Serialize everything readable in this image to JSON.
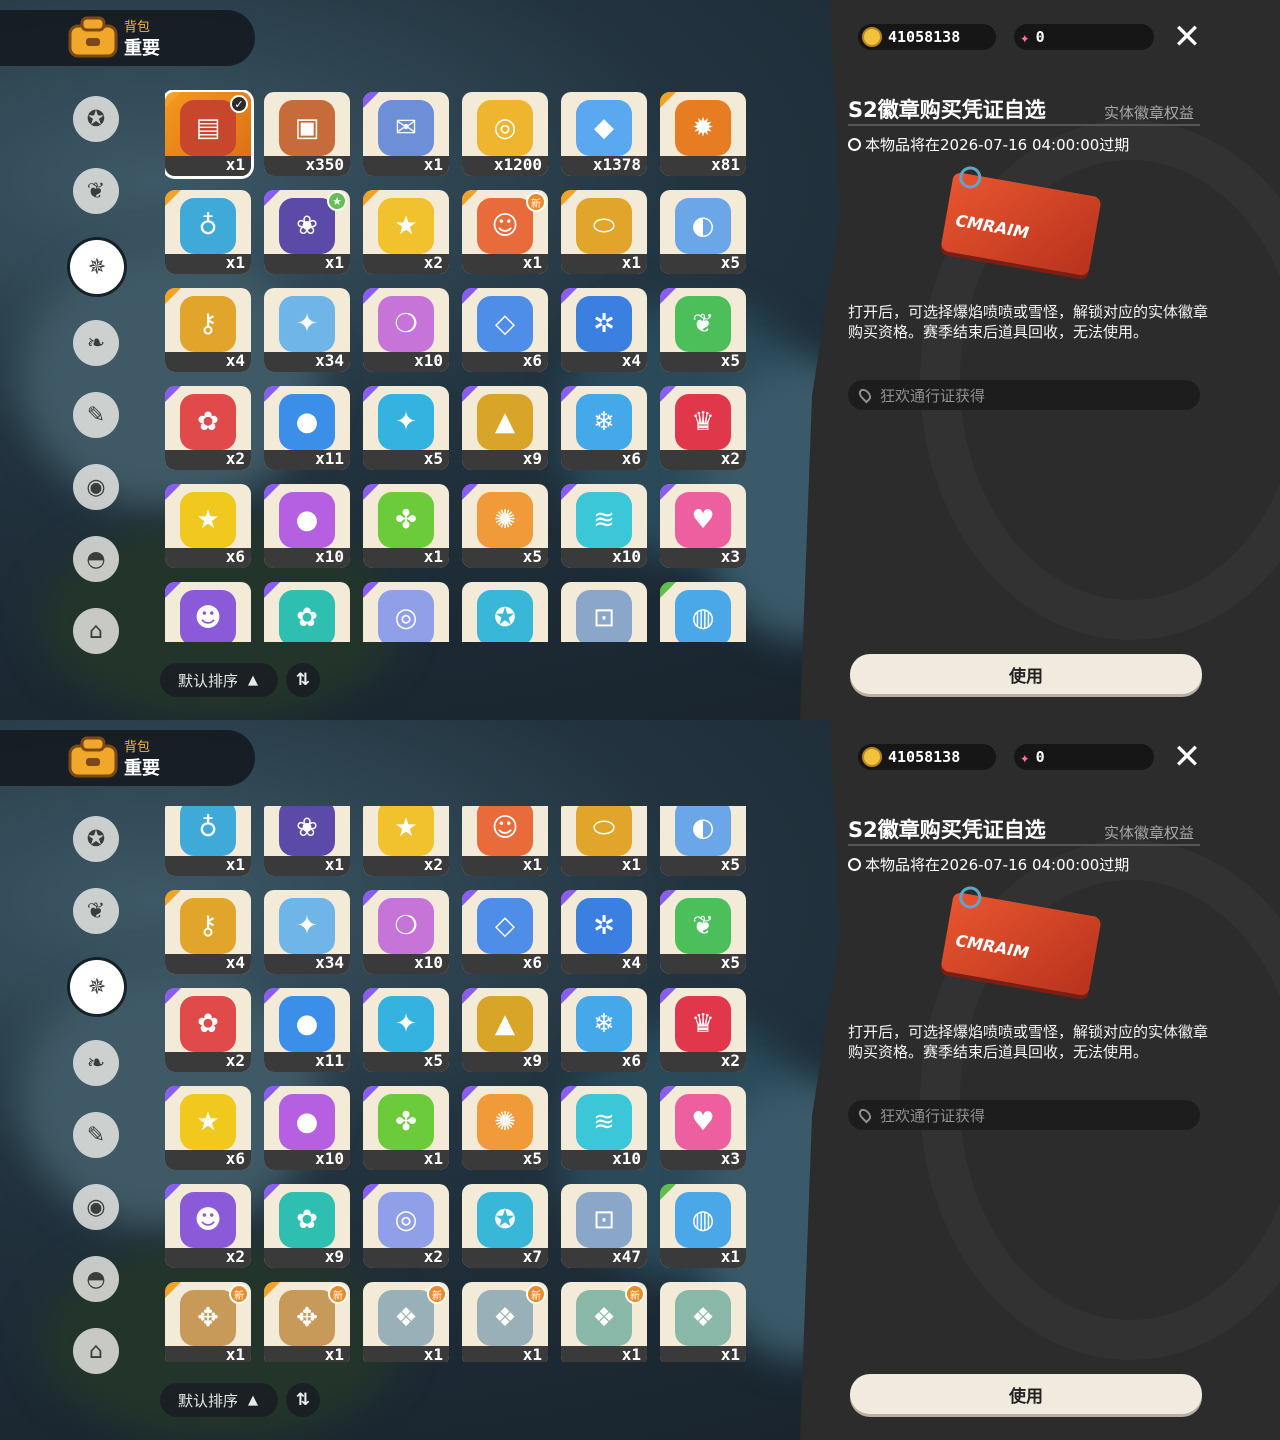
{
  "frames": [
    {
      "header": {
        "small_label": "背包",
        "big_label": "重要"
      },
      "categories": [
        {
          "icon": "star-badge-icon",
          "glyph": "✪",
          "active": false
        },
        {
          "icon": "leaf-sprout-icon",
          "glyph": "❦",
          "active": false
        },
        {
          "icon": "spiky-star-icon",
          "glyph": "✵",
          "active": true
        },
        {
          "icon": "leaves-icon",
          "glyph": "❧",
          "active": false
        },
        {
          "icon": "scroll-card-icon",
          "glyph": "✎",
          "active": false
        },
        {
          "icon": "egg-dots-icon",
          "glyph": "◉",
          "active": false
        },
        {
          "icon": "acorn-icon",
          "glyph": "◓",
          "active": false
        },
        {
          "icon": "armchair-icon",
          "glyph": "⌂",
          "active": false
        }
      ],
      "items": [
        {
          "name": "ticket",
          "qty": "x1",
          "color": "#c8462b",
          "glyph": "▤",
          "rarity": "orange",
          "selected": true,
          "badge": "check"
        },
        {
          "name": "card",
          "qty": "x350",
          "color": "#c86b3a",
          "glyph": "▣",
          "rarity": "",
          "badge": ""
        },
        {
          "name": "letter",
          "qty": "x1",
          "color": "#6d8fd8",
          "glyph": "✉",
          "rarity": "purple",
          "badge": ""
        },
        {
          "name": "camera",
          "qty": "x1200",
          "color": "#f0b52e",
          "glyph": "◎",
          "rarity": "",
          "badge": ""
        },
        {
          "name": "prism",
          "qty": "x1378",
          "color": "#5aa8f0",
          "glyph": "◆",
          "rarity": "",
          "badge": ""
        },
        {
          "name": "sun-coin",
          "qty": "x81",
          "color": "#e67d22",
          "glyph": "✹",
          "rarity": "orange",
          "badge": ""
        },
        {
          "name": "blue-flask",
          "qty": "x1",
          "color": "#3fa9d8",
          "glyph": "♁",
          "rarity": "orange",
          "badge": ""
        },
        {
          "name": "pouch",
          "qty": "x1",
          "color": "#5c4aa8",
          "glyph": "❀",
          "rarity": "purple",
          "badge": "star"
        },
        {
          "name": "gold-star",
          "qty": "x2",
          "color": "#f2c12e",
          "glyph": "★",
          "rarity": "orange",
          "badge": ""
        },
        {
          "name": "mask",
          "qty": "x1",
          "color": "#e96a3a",
          "glyph": "☺",
          "rarity": "orange",
          "badge": "new"
        },
        {
          "name": "mirror",
          "qty": "x1",
          "color": "#e0a52a",
          "glyph": "⬭",
          "rarity": "orange",
          "badge": ""
        },
        {
          "name": "blue-orb",
          "qty": "x5",
          "color": "#6aa6e8",
          "glyph": "◐",
          "rarity": "",
          "badge": ""
        },
        {
          "name": "gold-key",
          "qty": "x4",
          "color": "#e0a52a",
          "glyph": "⚷",
          "rarity": "orange",
          "badge": ""
        },
        {
          "name": "star-wand",
          "qty": "x34",
          "color": "#6fb5e8",
          "glyph": "✦",
          "rarity": "",
          "badge": ""
        },
        {
          "name": "rainbow-potion",
          "qty": "x10",
          "color": "#c774d8",
          "glyph": "❍",
          "rarity": "purple",
          "badge": ""
        },
        {
          "name": "crystal-potion",
          "qty": "x6",
          "color": "#4f8ee8",
          "glyph": "◇",
          "rarity": "purple",
          "badge": ""
        },
        {
          "name": "blue-potion",
          "qty": "x4",
          "color": "#3b7fe0",
          "glyph": "✲",
          "rarity": "purple",
          "badge": ""
        },
        {
          "name": "green-potion",
          "qty": "x5",
          "color": "#4cbf5a",
          "glyph": "❦",
          "rarity": "purple",
          "badge": ""
        },
        {
          "name": "red-potion",
          "qty": "x2",
          "color": "#e04a4a",
          "glyph": "✿",
          "rarity": "purple",
          "badge": ""
        },
        {
          "name": "blue-drop-potion",
          "qty": "x11",
          "color": "#3b8fe8",
          "glyph": "●",
          "rarity": "purple",
          "badge": ""
        },
        {
          "name": "cyan-potion",
          "qty": "x5",
          "color": "#35b3e0",
          "glyph": "✦",
          "rarity": "purple",
          "badge": ""
        },
        {
          "name": "gold-potion",
          "qty": "x9",
          "color": "#d8a528",
          "glyph": "▲",
          "rarity": "purple",
          "badge": ""
        },
        {
          "name": "sky-potion",
          "qty": "x6",
          "color": "#45a8e8",
          "glyph": "❄",
          "rarity": "purple",
          "badge": ""
        },
        {
          "name": "crown-potion",
          "qty": "x2",
          "color": "#e0374a",
          "glyph": "♛",
          "rarity": "purple",
          "badge": ""
        },
        {
          "name": "yellow-potion",
          "qty": "x6",
          "color": "#f0c81e",
          "glyph": "★",
          "rarity": "purple",
          "badge": ""
        },
        {
          "name": "violet-potion",
          "qty": "x10",
          "color": "#b560e0",
          "glyph": "●",
          "rarity": "purple",
          "badge": ""
        },
        {
          "name": "lime-potion",
          "qty": "x1",
          "color": "#6ccb3a",
          "glyph": "✤",
          "rarity": "purple",
          "badge": ""
        },
        {
          "name": "orange-potion",
          "qty": "x5",
          "color": "#f09a3a",
          "glyph": "✺",
          "rarity": "purple",
          "badge": ""
        },
        {
          "name": "teal-potion",
          "qty": "x10",
          "color": "#3bc7d8",
          "glyph": "≋",
          "rarity": "purple",
          "badge": ""
        },
        {
          "name": "pink-potion",
          "qty": "x3",
          "color": "#ee5fa0",
          "glyph": "♥",
          "rarity": "purple",
          "badge": ""
        },
        {
          "name": "purple-ghost-potion",
          "qty": "",
          "color": "#8a5ad8",
          "glyph": "☻",
          "rarity": "purple",
          "badge": ""
        },
        {
          "name": "teal-flower-potion",
          "qty": "",
          "color": "#2fbfb0",
          "glyph": "✿",
          "rarity": "purple",
          "badge": ""
        },
        {
          "name": "swirl-potion",
          "qty": "",
          "color": "#8fa0e8",
          "glyph": "◎",
          "rarity": "purple",
          "badge": ""
        },
        {
          "name": "blue-star",
          "qty": "",
          "color": "#38b7d8",
          "glyph": "✪",
          "rarity": "",
          "badge": ""
        },
        {
          "name": "robot-coin",
          "qty": "",
          "color": "#8aa6c8",
          "glyph": "⊡",
          "rarity": "",
          "badge": ""
        },
        {
          "name": "crystal-ball",
          "qty": "",
          "color": "#4aa8e8",
          "glyph": "◍",
          "rarity": "green",
          "badge": ""
        }
      ],
      "sort": {
        "label": "默认排序",
        "arrow": "▲",
        "toggle": "⇅"
      },
      "panel": {
        "coins": "41058138",
        "gems": "0",
        "close": "✕",
        "title": "S2徽章购买凭证自选",
        "tag": "实体徽章权益",
        "expire": "本物品将在2026-07-16 04:00:00过期",
        "big_item_text": "CMRAIM",
        "description": "打开后，可选择爆焰喷喷或雪怪，解锁对应的实体徽章购买资格。赛季结束后道具回收，无法使用。",
        "source": "狂欢通行证获得",
        "use_button": "使用"
      }
    },
    {
      "header": {
        "small_label": "背包",
        "big_label": "重要"
      },
      "categories": [
        {
          "icon": "star-badge-icon",
          "glyph": "✪",
          "active": false
        },
        {
          "icon": "leaf-sprout-icon",
          "glyph": "❦",
          "active": false
        },
        {
          "icon": "spiky-star-icon",
          "glyph": "✵",
          "active": true
        },
        {
          "icon": "leaves-icon",
          "glyph": "❧",
          "active": false
        },
        {
          "icon": "scroll-card-icon",
          "glyph": "✎",
          "active": false
        },
        {
          "icon": "egg-dots-icon",
          "glyph": "◉",
          "active": false
        },
        {
          "icon": "acorn-icon",
          "glyph": "◓",
          "active": false
        },
        {
          "icon": "armchair-icon",
          "glyph": "⌂",
          "active": false
        }
      ],
      "items": [
        {
          "name": "blue-flask",
          "qty": "x1",
          "color": "#3fa9d8",
          "glyph": "♁",
          "rarity": "orange",
          "badge": ""
        },
        {
          "name": "pouch",
          "qty": "x1",
          "color": "#5c4aa8",
          "glyph": "❀",
          "rarity": "purple",
          "badge": ""
        },
        {
          "name": "gold-star",
          "qty": "x2",
          "color": "#f2c12e",
          "glyph": "★",
          "rarity": "orange",
          "badge": ""
        },
        {
          "name": "mask",
          "qty": "x1",
          "color": "#e96a3a",
          "glyph": "☺",
          "rarity": "orange",
          "badge": ""
        },
        {
          "name": "mirror",
          "qty": "x1",
          "color": "#e0a52a",
          "glyph": "⬭",
          "rarity": "orange",
          "badge": ""
        },
        {
          "name": "blue-orb",
          "qty": "x5",
          "color": "#6aa6e8",
          "glyph": "◐",
          "rarity": "",
          "badge": ""
        },
        {
          "name": "gold-key",
          "qty": "x4",
          "color": "#e0a52a",
          "glyph": "⚷",
          "rarity": "orange",
          "badge": ""
        },
        {
          "name": "star-wand",
          "qty": "x34",
          "color": "#6fb5e8",
          "glyph": "✦",
          "rarity": "",
          "badge": ""
        },
        {
          "name": "rainbow-potion",
          "qty": "x10",
          "color": "#c774d8",
          "glyph": "❍",
          "rarity": "purple",
          "badge": ""
        },
        {
          "name": "crystal-potion",
          "qty": "x6",
          "color": "#4f8ee8",
          "glyph": "◇",
          "rarity": "purple",
          "badge": ""
        },
        {
          "name": "blue-potion",
          "qty": "x4",
          "color": "#3b7fe0",
          "glyph": "✲",
          "rarity": "purple",
          "badge": ""
        },
        {
          "name": "green-potion",
          "qty": "x5",
          "color": "#4cbf5a",
          "glyph": "❦",
          "rarity": "purple",
          "badge": ""
        },
        {
          "name": "red-potion",
          "qty": "x2",
          "color": "#e04a4a",
          "glyph": "✿",
          "rarity": "purple",
          "badge": ""
        },
        {
          "name": "blue-drop-potion",
          "qty": "x11",
          "color": "#3b8fe8",
          "glyph": "●",
          "rarity": "purple",
          "badge": ""
        },
        {
          "name": "cyan-potion",
          "qty": "x5",
          "color": "#35b3e0",
          "glyph": "✦",
          "rarity": "purple",
          "badge": ""
        },
        {
          "name": "gold-potion",
          "qty": "x9",
          "color": "#d8a528",
          "glyph": "▲",
          "rarity": "purple",
          "badge": ""
        },
        {
          "name": "sky-potion",
          "qty": "x6",
          "color": "#45a8e8",
          "glyph": "❄",
          "rarity": "purple",
          "badge": ""
        },
        {
          "name": "crown-potion",
          "qty": "x2",
          "color": "#e0374a",
          "glyph": "♛",
          "rarity": "purple",
          "badge": ""
        },
        {
          "name": "yellow-potion",
          "qty": "x6",
          "color": "#f0c81e",
          "glyph": "★",
          "rarity": "purple",
          "badge": ""
        },
        {
          "name": "violet-potion",
          "qty": "x10",
          "color": "#b560e0",
          "glyph": "●",
          "rarity": "purple",
          "badge": ""
        },
        {
          "name": "lime-potion",
          "qty": "x1",
          "color": "#6ccb3a",
          "glyph": "✤",
          "rarity": "purple",
          "badge": ""
        },
        {
          "name": "orange-potion",
          "qty": "x5",
          "color": "#f09a3a",
          "glyph": "✺",
          "rarity": "purple",
          "badge": ""
        },
        {
          "name": "teal-potion",
          "qty": "x10",
          "color": "#3bc7d8",
          "glyph": "≋",
          "rarity": "purple",
          "badge": ""
        },
        {
          "name": "pink-potion",
          "qty": "x3",
          "color": "#ee5fa0",
          "glyph": "♥",
          "rarity": "purple",
          "badge": ""
        },
        {
          "name": "purple-ghost-potion",
          "qty": "x2",
          "color": "#8a5ad8",
          "glyph": "☻",
          "rarity": "purple",
          "badge": ""
        },
        {
          "name": "teal-flower-potion",
          "qty": "x9",
          "color": "#2fbfb0",
          "glyph": "✿",
          "rarity": "purple",
          "badge": ""
        },
        {
          "name": "swirl-potion",
          "qty": "x2",
          "color": "#8fa0e8",
          "glyph": "◎",
          "rarity": "purple",
          "badge": ""
        },
        {
          "name": "blue-star",
          "qty": "x7",
          "color": "#38b7d8",
          "glyph": "✪",
          "rarity": "",
          "badge": ""
        },
        {
          "name": "robot-coin",
          "qty": "x47",
          "color": "#8aa6c8",
          "glyph": "⊡",
          "rarity": "",
          "badge": ""
        },
        {
          "name": "crystal-ball",
          "qty": "x1",
          "color": "#4aa8e8",
          "glyph": "◍",
          "rarity": "green",
          "badge": ""
        },
        {
          "name": "paw-map",
          "qty": "x1",
          "color": "#c89a5a",
          "glyph": "✥",
          "rarity": "orange",
          "badge": "new"
        },
        {
          "name": "paw-map-2",
          "qty": "x1",
          "color": "#c89a5a",
          "glyph": "✥",
          "rarity": "orange",
          "badge": "new"
        },
        {
          "name": "scroll-blue",
          "qty": "x1",
          "color": "#9ab0b8",
          "glyph": "❖",
          "rarity": "",
          "badge": "new"
        },
        {
          "name": "scroll-blue-2",
          "qty": "x1",
          "color": "#9ab0b8",
          "glyph": "❖",
          "rarity": "",
          "badge": "new"
        },
        {
          "name": "scroll-teal",
          "qty": "x1",
          "color": "#8ab8a8",
          "glyph": "❖",
          "rarity": "",
          "badge": "new"
        },
        {
          "name": "scroll-teal-2",
          "qty": "x1",
          "color": "#8ab8a8",
          "glyph": "❖",
          "rarity": "",
          "badge": ""
        }
      ],
      "sort": {
        "label": "默认排序",
        "arrow": "▲",
        "toggle": "⇅"
      },
      "panel": {
        "coins": "41058138",
        "gems": "0",
        "close": "✕",
        "title": "S2徽章购买凭证自选",
        "tag": "实体徽章权益",
        "expire": "本物品将在2026-07-16 04:00:00过期",
        "big_item_text": "CMRAIM",
        "description": "打开后，可选择爆焰喷喷或雪怪，解锁对应的实体徽章购买资格。赛季结束后道具回收，无法使用。",
        "source": "狂欢通行证获得",
        "use_button": "使用"
      }
    }
  ],
  "badges": {
    "new": "新",
    "check": "✓",
    "star": "★"
  },
  "colors": {
    "accent_orange": "#f39a1e",
    "panel_bg": "#2b2c2b",
    "rarity_purple": "#8a5cf0",
    "rarity_orange": "#f2a226",
    "rarity_green": "#5fbf4a"
  }
}
